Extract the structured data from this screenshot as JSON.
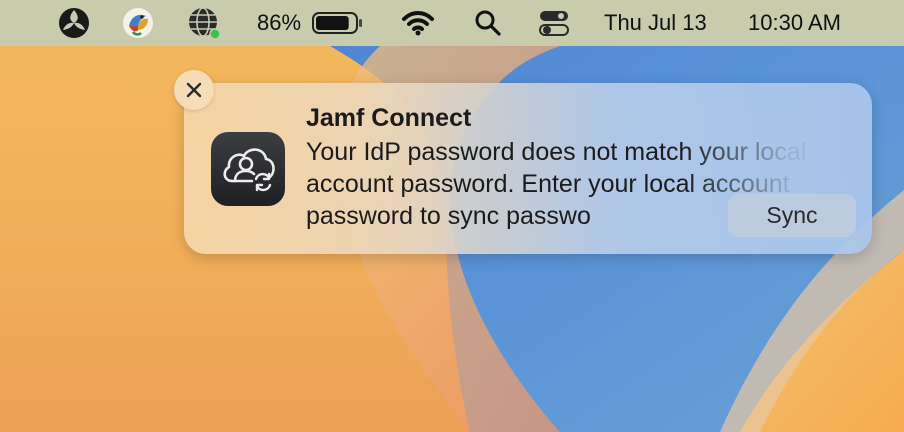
{
  "menubar": {
    "icons": [
      "jamf-icon",
      "colorful-bird-icon",
      "globe-network-icon"
    ],
    "battery": {
      "percent_label": "86%",
      "level": 0.86
    },
    "status_icons": [
      "wifi-icon",
      "search-icon",
      "control-center-icon"
    ],
    "date": "Thu Jul 13",
    "time": "10:30 AM"
  },
  "notification": {
    "app_name": "Jamf Connect",
    "message": "Your IdP password does not match your local account password. Enter your local account password to sync passwo",
    "action_label": "Sync",
    "close_icon": "close-icon",
    "app_icon": "cloud-user-sync-icon"
  },
  "colors": {
    "menubar_bg": "#c6ccb4",
    "wallpaper_orange": "#f2b85e",
    "wallpaper_blue": "#5b93d6"
  }
}
